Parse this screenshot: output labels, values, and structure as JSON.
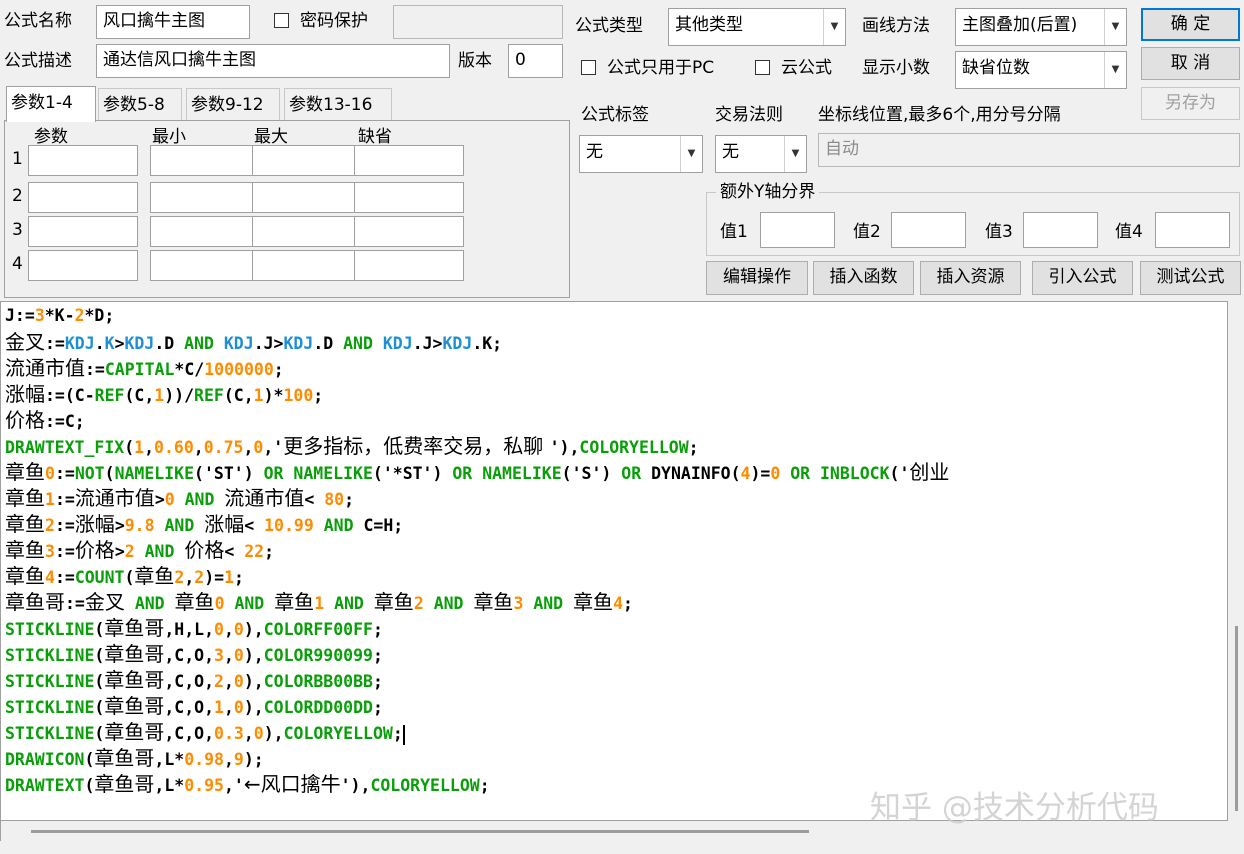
{
  "formula_name": {
    "label": "公式名称",
    "value": "风口擒牛主图"
  },
  "password": {
    "label": "密码保护",
    "value": ""
  },
  "formula_desc": {
    "label": "公式描述",
    "value": "通达信风口擒牛主图"
  },
  "version": {
    "label": "版本",
    "value": "0"
  },
  "formula_type": {
    "label": "公式类型",
    "value": "其他类型"
  },
  "draw_method": {
    "label": "画线方法",
    "value": "主图叠加(后置)"
  },
  "pc_only": {
    "label": "公式只用于PC"
  },
  "cloud": {
    "label": "云公式"
  },
  "decimals": {
    "label": "显示小数",
    "value": "缺省位数"
  },
  "buttons": {
    "ok": "确 定",
    "cancel": "取 消",
    "save_as": "另存为"
  },
  "tabs": [
    "参数1-4",
    "参数5-8",
    "参数9-12",
    "参数13-16"
  ],
  "param_table": {
    "headers": [
      "参数",
      "最小",
      "最大",
      "缺省"
    ],
    "rows": [
      "1",
      "2",
      "3",
      "4"
    ]
  },
  "formula_tag": {
    "label": "公式标签",
    "value": "无"
  },
  "trade_rule": {
    "label": "交易法则",
    "value": "无"
  },
  "axis_positions": {
    "label": "坐标线位置,最多6个,用分号分隔",
    "value": "自动"
  },
  "extra_y": {
    "label": "额外Y轴分界",
    "values": [
      "值1",
      "值2",
      "值3",
      "值4"
    ]
  },
  "tool_buttons": [
    "编辑操作",
    "插入函数",
    "插入资源",
    "引入公式",
    "测试公式"
  ],
  "code_lines": [
    [
      [
        "d",
        "J:="
      ],
      [
        "n",
        "3"
      ],
      [
        "d",
        "*K-"
      ],
      [
        "n",
        "2"
      ],
      [
        "d",
        "*D;"
      ]
    ],
    [
      [
        "cn",
        "金叉"
      ],
      [
        "d",
        ":="
      ],
      [
        "b",
        "KDJ"
      ],
      [
        "d",
        "."
      ],
      [
        "b",
        "K"
      ],
      [
        "d",
        ">"
      ],
      [
        "b",
        "KDJ"
      ],
      [
        "d",
        ".D "
      ],
      [
        "k",
        "AND "
      ],
      [
        "b",
        "KDJ"
      ],
      [
        "d",
        ".J>"
      ],
      [
        "b",
        "KDJ"
      ],
      [
        "d",
        ".D "
      ],
      [
        "k",
        "AND "
      ],
      [
        "b",
        "KDJ"
      ],
      [
        "d",
        ".J>"
      ],
      [
        "b",
        "KDJ"
      ],
      [
        "d",
        ".K;"
      ]
    ],
    [
      [
        "cn",
        "流通市值"
      ],
      [
        "d",
        ":="
      ],
      [
        "k",
        "CAPITAL"
      ],
      [
        "d",
        "*C/"
      ],
      [
        "n",
        "1000000"
      ],
      [
        "d",
        ";"
      ]
    ],
    [
      [
        "cn",
        "涨幅"
      ],
      [
        "d",
        ":=(C-"
      ],
      [
        "k",
        "REF"
      ],
      [
        "d",
        "(C,"
      ],
      [
        "n",
        "1"
      ],
      [
        "d",
        "))/"
      ],
      [
        "k",
        "REF"
      ],
      [
        "d",
        "(C,"
      ],
      [
        "n",
        "1"
      ],
      [
        "d",
        ")*"
      ],
      [
        "n",
        "100"
      ],
      [
        "d",
        ";"
      ]
    ],
    [
      [
        "cn",
        "价格"
      ],
      [
        "d",
        ":=C;"
      ]
    ],
    [
      [
        "k",
        "DRAWTEXT_FIX"
      ],
      [
        "d",
        "("
      ],
      [
        "n",
        "1"
      ],
      [
        "d",
        ","
      ],
      [
        "n",
        "0.60"
      ],
      [
        "d",
        ","
      ],
      [
        "n",
        "0.75"
      ],
      [
        "d",
        ","
      ],
      [
        "n",
        "0"
      ],
      [
        "d",
        ",'"
      ],
      [
        "cn",
        "更多指标，低费率交易，私聊 "
      ],
      [
        "d",
        "'),"
      ],
      [
        "k",
        "COLORYELLOW"
      ],
      [
        "d",
        ";"
      ]
    ],
    [
      [
        "cn",
        "章鱼"
      ],
      [
        "n",
        "0"
      ],
      [
        "d",
        ":="
      ],
      [
        "k",
        "NOT"
      ],
      [
        "d",
        "("
      ],
      [
        "k",
        "NAMELIKE"
      ],
      [
        "d",
        "('ST') "
      ],
      [
        "k",
        "OR "
      ],
      [
        "k",
        "NAMELIKE"
      ],
      [
        "d",
        "('*ST') "
      ],
      [
        "k",
        "OR "
      ],
      [
        "k",
        "NAMELIKE"
      ],
      [
        "d",
        "('S') "
      ],
      [
        "k",
        "OR "
      ],
      [
        "d",
        "DYNAINFO("
      ],
      [
        "n",
        "4"
      ],
      [
        "d",
        ")="
      ],
      [
        "n",
        "0"
      ],
      [
        "d",
        " "
      ],
      [
        "k",
        "OR "
      ],
      [
        "k",
        "INBLOCK"
      ],
      [
        "d",
        "('"
      ],
      [
        "cn",
        "创业"
      ]
    ],
    [
      [
        "cn",
        "章鱼"
      ],
      [
        "n",
        "1"
      ],
      [
        "d",
        ":="
      ],
      [
        "cn",
        "流通市值"
      ],
      [
        "d",
        ">"
      ],
      [
        "n",
        "0"
      ],
      [
        "d",
        " "
      ],
      [
        "k",
        "AND "
      ],
      [
        "cn",
        "流通市值"
      ],
      [
        "d",
        "< "
      ],
      [
        "n",
        "80"
      ],
      [
        "d",
        ";"
      ]
    ],
    [
      [
        "cn",
        "章鱼"
      ],
      [
        "n",
        "2"
      ],
      [
        "d",
        ":="
      ],
      [
        "cn",
        "涨幅"
      ],
      [
        "d",
        ">"
      ],
      [
        "n",
        "9.8"
      ],
      [
        "d",
        " "
      ],
      [
        "k",
        "AND "
      ],
      [
        "cn",
        "涨幅"
      ],
      [
        "d",
        "< "
      ],
      [
        "n",
        "10.99"
      ],
      [
        "d",
        " "
      ],
      [
        "k",
        "AND "
      ],
      [
        "d",
        "C=H;"
      ]
    ],
    [
      [
        "cn",
        "章鱼"
      ],
      [
        "n",
        "3"
      ],
      [
        "d",
        ":="
      ],
      [
        "cn",
        "价格"
      ],
      [
        "d",
        ">"
      ],
      [
        "n",
        "2"
      ],
      [
        "d",
        " "
      ],
      [
        "k",
        "AND "
      ],
      [
        "cn",
        "价格"
      ],
      [
        "d",
        "< "
      ],
      [
        "n",
        "22"
      ],
      [
        "d",
        ";"
      ]
    ],
    [
      [
        "cn",
        "章鱼"
      ],
      [
        "n",
        "4"
      ],
      [
        "d",
        ":="
      ],
      [
        "k",
        "COUNT"
      ],
      [
        "d",
        "("
      ],
      [
        "cn",
        "章鱼"
      ],
      [
        "n",
        "2"
      ],
      [
        "d",
        ","
      ],
      [
        "n",
        "2"
      ],
      [
        "d",
        ")="
      ],
      [
        "n",
        "1"
      ],
      [
        "d",
        ";"
      ]
    ],
    [
      [
        "cn",
        "章鱼哥"
      ],
      [
        "d",
        ":="
      ],
      [
        "cn",
        "金叉"
      ],
      [
        "d",
        " "
      ],
      [
        "k",
        "AND "
      ],
      [
        "cn",
        "章鱼"
      ],
      [
        "n",
        "0"
      ],
      [
        "d",
        " "
      ],
      [
        "k",
        "AND "
      ],
      [
        "cn",
        "章鱼"
      ],
      [
        "n",
        "1"
      ],
      [
        "d",
        " "
      ],
      [
        "k",
        "AND "
      ],
      [
        "cn",
        "章鱼"
      ],
      [
        "n",
        "2"
      ],
      [
        "d",
        " "
      ],
      [
        "k",
        "AND "
      ],
      [
        "cn",
        "章鱼"
      ],
      [
        "n",
        "3"
      ],
      [
        "d",
        " "
      ],
      [
        "k",
        "AND "
      ],
      [
        "cn",
        "章鱼"
      ],
      [
        "n",
        "4"
      ],
      [
        "d",
        ";"
      ]
    ],
    [
      [
        "k",
        "STICKLINE"
      ],
      [
        "d",
        "("
      ],
      [
        "cn",
        "章鱼哥"
      ],
      [
        "d",
        ",H,L,"
      ],
      [
        "n",
        "0"
      ],
      [
        "d",
        ","
      ],
      [
        "n",
        "0"
      ],
      [
        "d",
        "),"
      ],
      [
        "k",
        "COLORFF00FF"
      ],
      [
        "d",
        ";"
      ]
    ],
    [
      [
        "k",
        "STICKLINE"
      ],
      [
        "d",
        "("
      ],
      [
        "cn",
        "章鱼哥"
      ],
      [
        "d",
        ",C,O,"
      ],
      [
        "n",
        "3"
      ],
      [
        "d",
        ","
      ],
      [
        "n",
        "0"
      ],
      [
        "d",
        "),"
      ],
      [
        "k",
        "COLOR990099"
      ],
      [
        "d",
        ";"
      ]
    ],
    [
      [
        "k",
        "STICKLINE"
      ],
      [
        "d",
        "("
      ],
      [
        "cn",
        "章鱼哥"
      ],
      [
        "d",
        ",C,O,"
      ],
      [
        "n",
        "2"
      ],
      [
        "d",
        ","
      ],
      [
        "n",
        "0"
      ],
      [
        "d",
        "),"
      ],
      [
        "k",
        "COLORBB00BB"
      ],
      [
        "d",
        ";"
      ]
    ],
    [
      [
        "k",
        "STICKLINE"
      ],
      [
        "d",
        "("
      ],
      [
        "cn",
        "章鱼哥"
      ],
      [
        "d",
        ",C,O,"
      ],
      [
        "n",
        "1"
      ],
      [
        "d",
        ","
      ],
      [
        "n",
        "0"
      ],
      [
        "d",
        "),"
      ],
      [
        "k",
        "COLORDD00DD"
      ],
      [
        "d",
        ";"
      ]
    ],
    [
      [
        "k",
        "STICKLINE"
      ],
      [
        "d",
        "("
      ],
      [
        "cn",
        "章鱼哥"
      ],
      [
        "d",
        ",C,O,"
      ],
      [
        "n",
        "0.3"
      ],
      [
        "d",
        ","
      ],
      [
        "n",
        "0"
      ],
      [
        "d",
        "),"
      ],
      [
        "k",
        "COLORYELLOW"
      ],
      [
        "d",
        ";"
      ]
    ],
    [
      [
        "k",
        "DRAWICON"
      ],
      [
        "d",
        "("
      ],
      [
        "cn",
        "章鱼哥"
      ],
      [
        "d",
        ",L*"
      ],
      [
        "n",
        "0.98"
      ],
      [
        "d",
        ","
      ],
      [
        "n",
        "9"
      ],
      [
        "d",
        ");"
      ]
    ],
    [
      [
        "k",
        "DRAWTEXT"
      ],
      [
        "d",
        "("
      ],
      [
        "cn",
        "章鱼哥"
      ],
      [
        "d",
        ",L*"
      ],
      [
        "n",
        "0.95"
      ],
      [
        "d",
        ",'"
      ],
      [
        "cn",
        "←风口擒牛"
      ],
      [
        "d",
        "'),"
      ],
      [
        "k",
        "COLORYELLOW"
      ],
      [
        "d",
        ";"
      ]
    ]
  ],
  "watermark": "知乎 @技术分析代码",
  "colors": {
    "keyword": "#0a9e0a",
    "builtin": "#1e8fd5",
    "number": "#ff8c00",
    "default_btn_border": "#0078d7"
  }
}
